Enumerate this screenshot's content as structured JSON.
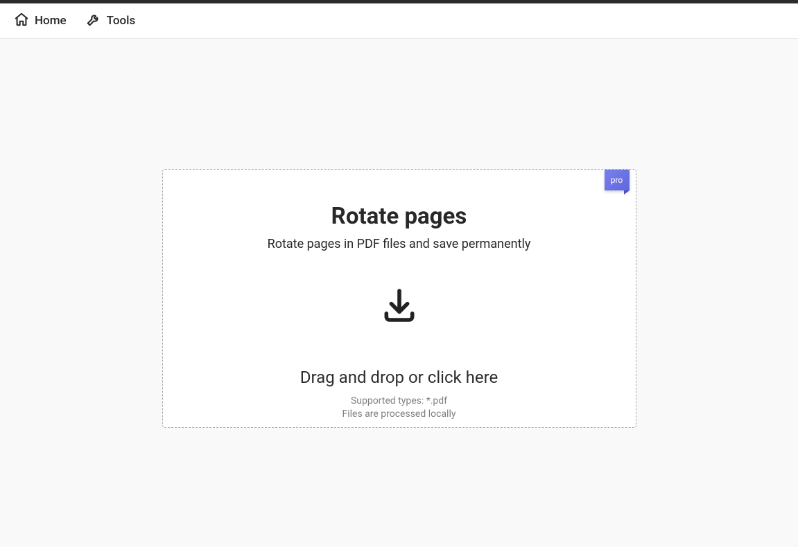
{
  "nav": {
    "home": "Home",
    "tools": "Tools"
  },
  "badge": {
    "pro": "pro"
  },
  "dropzone": {
    "title": "Rotate pages",
    "subtitle": "Rotate pages in PDF files and save permanently",
    "cta": "Drag and drop or click here",
    "supported": "Supported types: *.pdf",
    "local": "Files are processed locally"
  }
}
